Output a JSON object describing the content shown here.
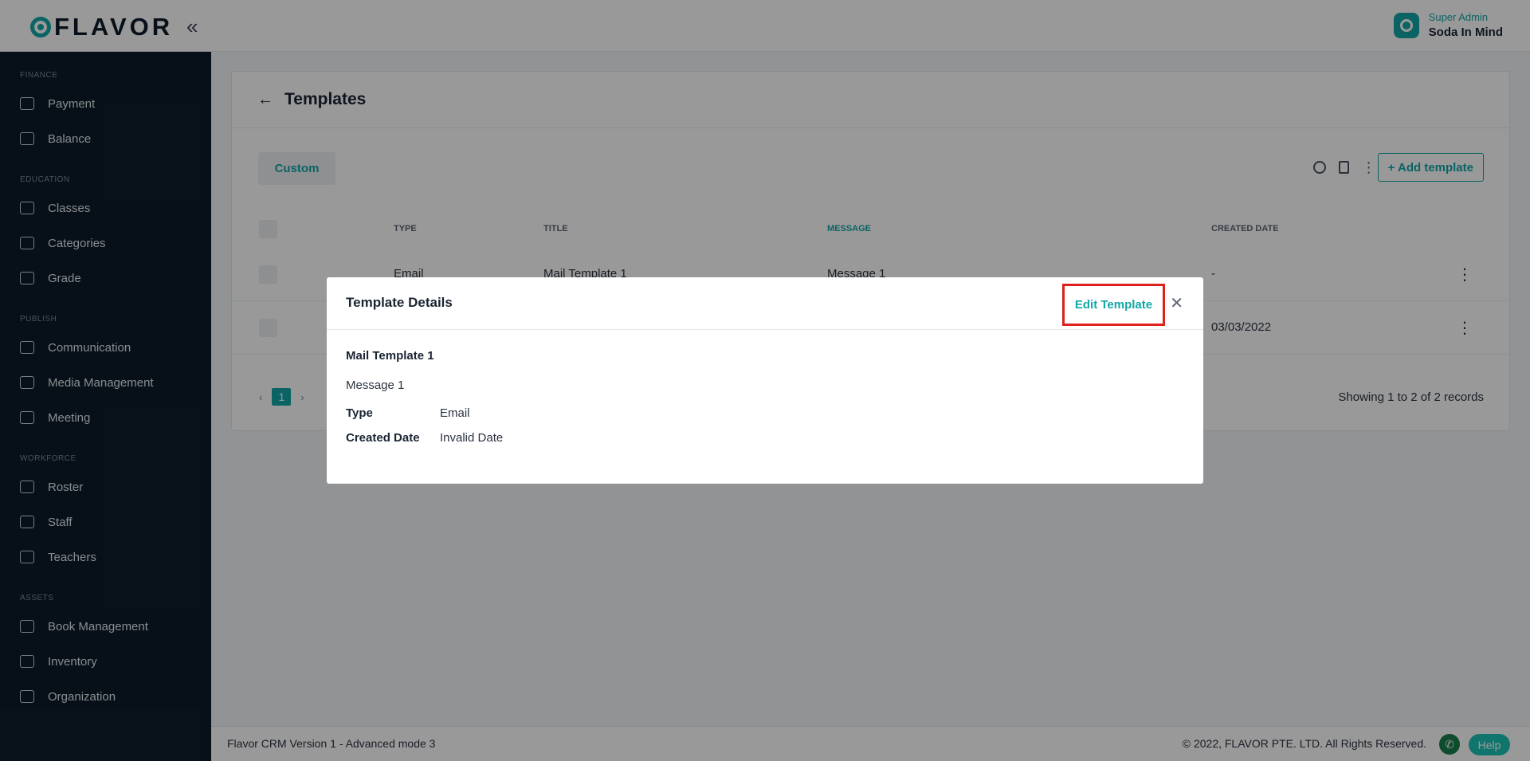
{
  "brand": {
    "logo_text": "FLAVOR"
  },
  "user": {
    "role": "Super Admin",
    "name": "Soda In Mind"
  },
  "sidebar": {
    "sections": [
      {
        "title": "FINANCE",
        "items": [
          "Payment",
          "Balance"
        ]
      },
      {
        "title": "EDUCATION",
        "items": [
          "Classes",
          "Categories",
          "Grade"
        ]
      },
      {
        "title": "PUBLISH",
        "items": [
          "Communication",
          "Media Management",
          "Meeting"
        ]
      },
      {
        "title": "WORKFORCE",
        "items": [
          "Roster",
          "Staff",
          "Teachers"
        ]
      },
      {
        "title": "ASSETS",
        "items": [
          "Book Management",
          "Inventory",
          "Organization"
        ]
      }
    ]
  },
  "page": {
    "title": "Templates",
    "tab": "Custom",
    "add_button": "+ Add template",
    "columns": [
      "TYPE",
      "TITLE",
      "MESSAGE",
      "CREATED DATE"
    ],
    "rows": [
      {
        "type": "Email",
        "title": "Mail Template 1",
        "message": "Message 1",
        "created": "-"
      },
      {
        "type": "",
        "title": "",
        "message": "",
        "created": "03/03/2022"
      }
    ],
    "pagination": {
      "current": "1"
    },
    "records": "Showing 1 to 2 of 2 records"
  },
  "footer": {
    "version": "Flavor CRM Version 1 - Advanced mode 3",
    "copyright": "© 2022, FLAVOR PTE. LTD. All Rights Reserved.",
    "help": "Help"
  },
  "modal": {
    "title": "Template Details",
    "edit_label": "Edit Template",
    "template_title": "Mail Template 1",
    "message": "Message 1",
    "type_label": "Type",
    "type_value": "Email",
    "date_label": "Created Date",
    "date_value": "Invalid Date"
  },
  "colors": {
    "accent": "#13a5a7",
    "sidebar": "#0d1b2a",
    "highlight": "#e0201b"
  }
}
